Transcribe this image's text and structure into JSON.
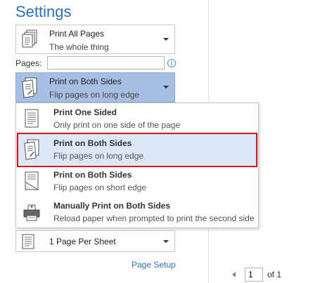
{
  "settings": {
    "title": "Settings",
    "pages_dropdown": {
      "title": "Print All Pages",
      "subtitle": "The whole thing",
      "icon": "pages-stack-icon"
    },
    "pages_field": {
      "label": "Pages:",
      "value": "",
      "info_icon": "info-icon",
      "info_glyph": "i"
    },
    "sides_dropdown": {
      "title": "Print on Both Sides",
      "subtitle": "Flip pages on long edge",
      "icon": "duplex-long-edge-icon"
    },
    "sheet_dropdown": {
      "title": "1 Page Per Sheet",
      "icon": "page-per-sheet-icon"
    },
    "page_setup_link": "Page Setup"
  },
  "sides_menu": {
    "items": [
      {
        "title": "Print One Sided",
        "subtitle": "Only print on one side of the page",
        "icon": "one-sided-icon",
        "selected": false
      },
      {
        "title": "Print on Both Sides",
        "subtitle": "Flip pages on long edge",
        "icon": "duplex-long-edge-icon",
        "selected": true
      },
      {
        "title": "Print on Both Sides",
        "subtitle": "Flip pages on short edge",
        "icon": "duplex-short-edge-icon",
        "selected": false
      },
      {
        "title": "Manually Print on Both Sides",
        "subtitle": "Reload paper when prompted to print the second side",
        "icon": "manual-duplex-printer-icon",
        "selected": false
      }
    ]
  },
  "preview_pager": {
    "current_page": "1",
    "of_label": "of 1"
  },
  "colors": {
    "accent": "#2e6fb7",
    "selected_dropdown": "#a7bfe3",
    "selected_item": "#dbe7f6",
    "highlight_border": "#d6141b"
  }
}
